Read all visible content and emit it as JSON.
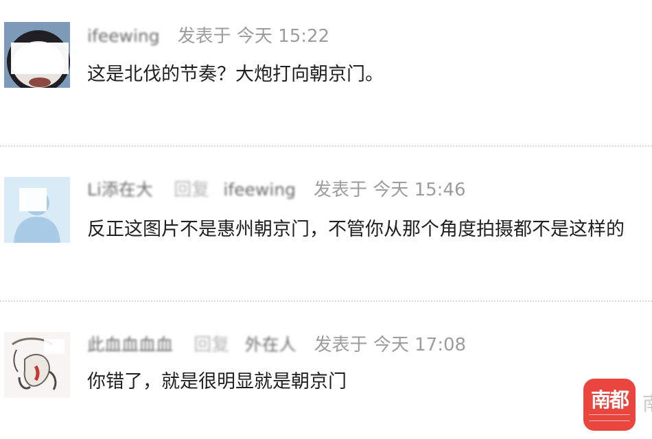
{
  "comments": [
    {
      "username": "ifeewing",
      "reply_prefix": "",
      "reply_target": "",
      "posted": "发表于 今天 15:22",
      "text": "这是北伐的节奏？大炮打向朝京门。"
    },
    {
      "username": "Li添在大",
      "reply_prefix": "回复",
      "reply_target": "ifeewing",
      "posted": "发表于 今天 15:46",
      "text": "反正这图片不是惠州朝京门，不管你从那个角度拍摄都不是这样的"
    },
    {
      "username": "此血血血血",
      "reply_prefix": "回复",
      "reply_target": "外在人",
      "posted": "发表于 今天 17:08",
      "text": "你错了，就是很明显就是朝京门"
    }
  ],
  "watermark": {
    "logo_text": "南都",
    "side_text": "南"
  },
  "colors": {
    "logo": "#e8463f",
    "divider": "#d8d8d8",
    "meta": "#a3a3a3",
    "body": "#1f1f1f"
  }
}
